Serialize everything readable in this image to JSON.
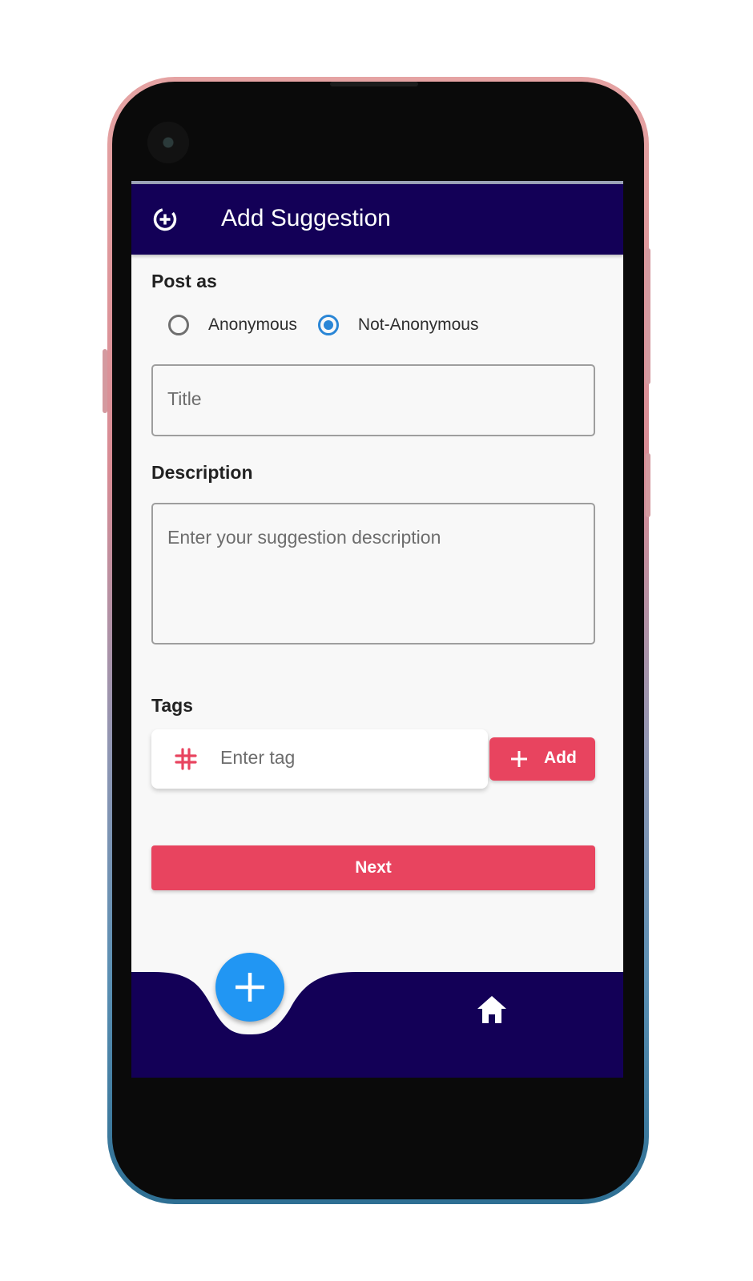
{
  "app_bar": {
    "title": "Add Suggestion",
    "icon": "add-circle-icon"
  },
  "post_as": {
    "label": "Post as",
    "options": [
      {
        "label": "Anonymous",
        "selected": false
      },
      {
        "label": "Not-Anonymous",
        "selected": true
      }
    ]
  },
  "title_field": {
    "placeholder": "Title",
    "value": ""
  },
  "description": {
    "label": "Description",
    "placeholder": "Enter your suggestion description",
    "value": ""
  },
  "tags": {
    "label": "Tags",
    "placeholder": "Enter tag",
    "icon": "hash-icon",
    "add_label": "Add"
  },
  "next_label": "Next",
  "bottom_nav": {
    "fab_icon": "plus-icon",
    "home_icon": "home-icon"
  },
  "colors": {
    "app_bar": "#130057",
    "accent": "#e8445f",
    "fab": "#2196f3",
    "radio": "#2a86d6"
  }
}
